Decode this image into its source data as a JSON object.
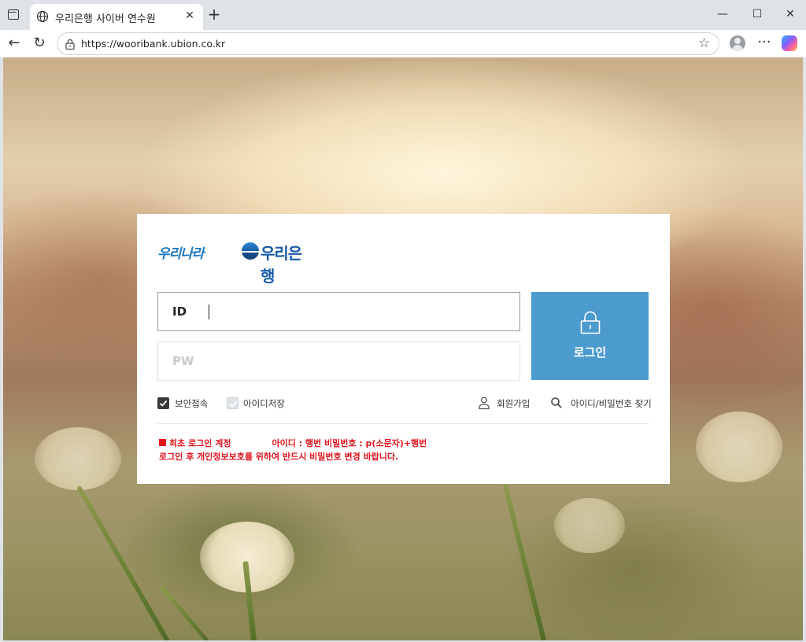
{
  "browser": {
    "tab_title": "우리은행 사이버 연수원",
    "url": "https://wooribank.ubion.co.kr",
    "close_tab_glyph": "✕",
    "new_tab_glyph": "+",
    "minimize_glyph": "—",
    "maximize_glyph": "☐",
    "close_window_glyph": "✕",
    "back_glyph": "←",
    "reload_glyph": "↻",
    "more_glyph": "···",
    "favorite_glyph": "☆"
  },
  "logo": {
    "slogan": "우리나라",
    "bank_name": "우리은행"
  },
  "login": {
    "id_label": "ID",
    "id_value": "",
    "pw_label": "PW",
    "pw_value": "",
    "submit_label": "로그인"
  },
  "options": {
    "secure_connect": {
      "label": "보안접속",
      "checked": true
    },
    "save_id": {
      "label": "아이디저장",
      "checked": false
    },
    "signup_label": "회원가입",
    "find_label": "아이디/비밀번호 찾기"
  },
  "notice": {
    "line1_prefix": "최초 로그인 계정",
    "line1_detail": "아이디 : 행번  비밀번호 : p(소문자)+행번",
    "line2": "로그인 후 개인정보보호를 위하여 반드시 비밀번호 변경 바랍니다."
  },
  "colors": {
    "login_button": "#4b9bcf",
    "notice_text": "#e0141d",
    "logo_blue": "#1a5ba6"
  }
}
